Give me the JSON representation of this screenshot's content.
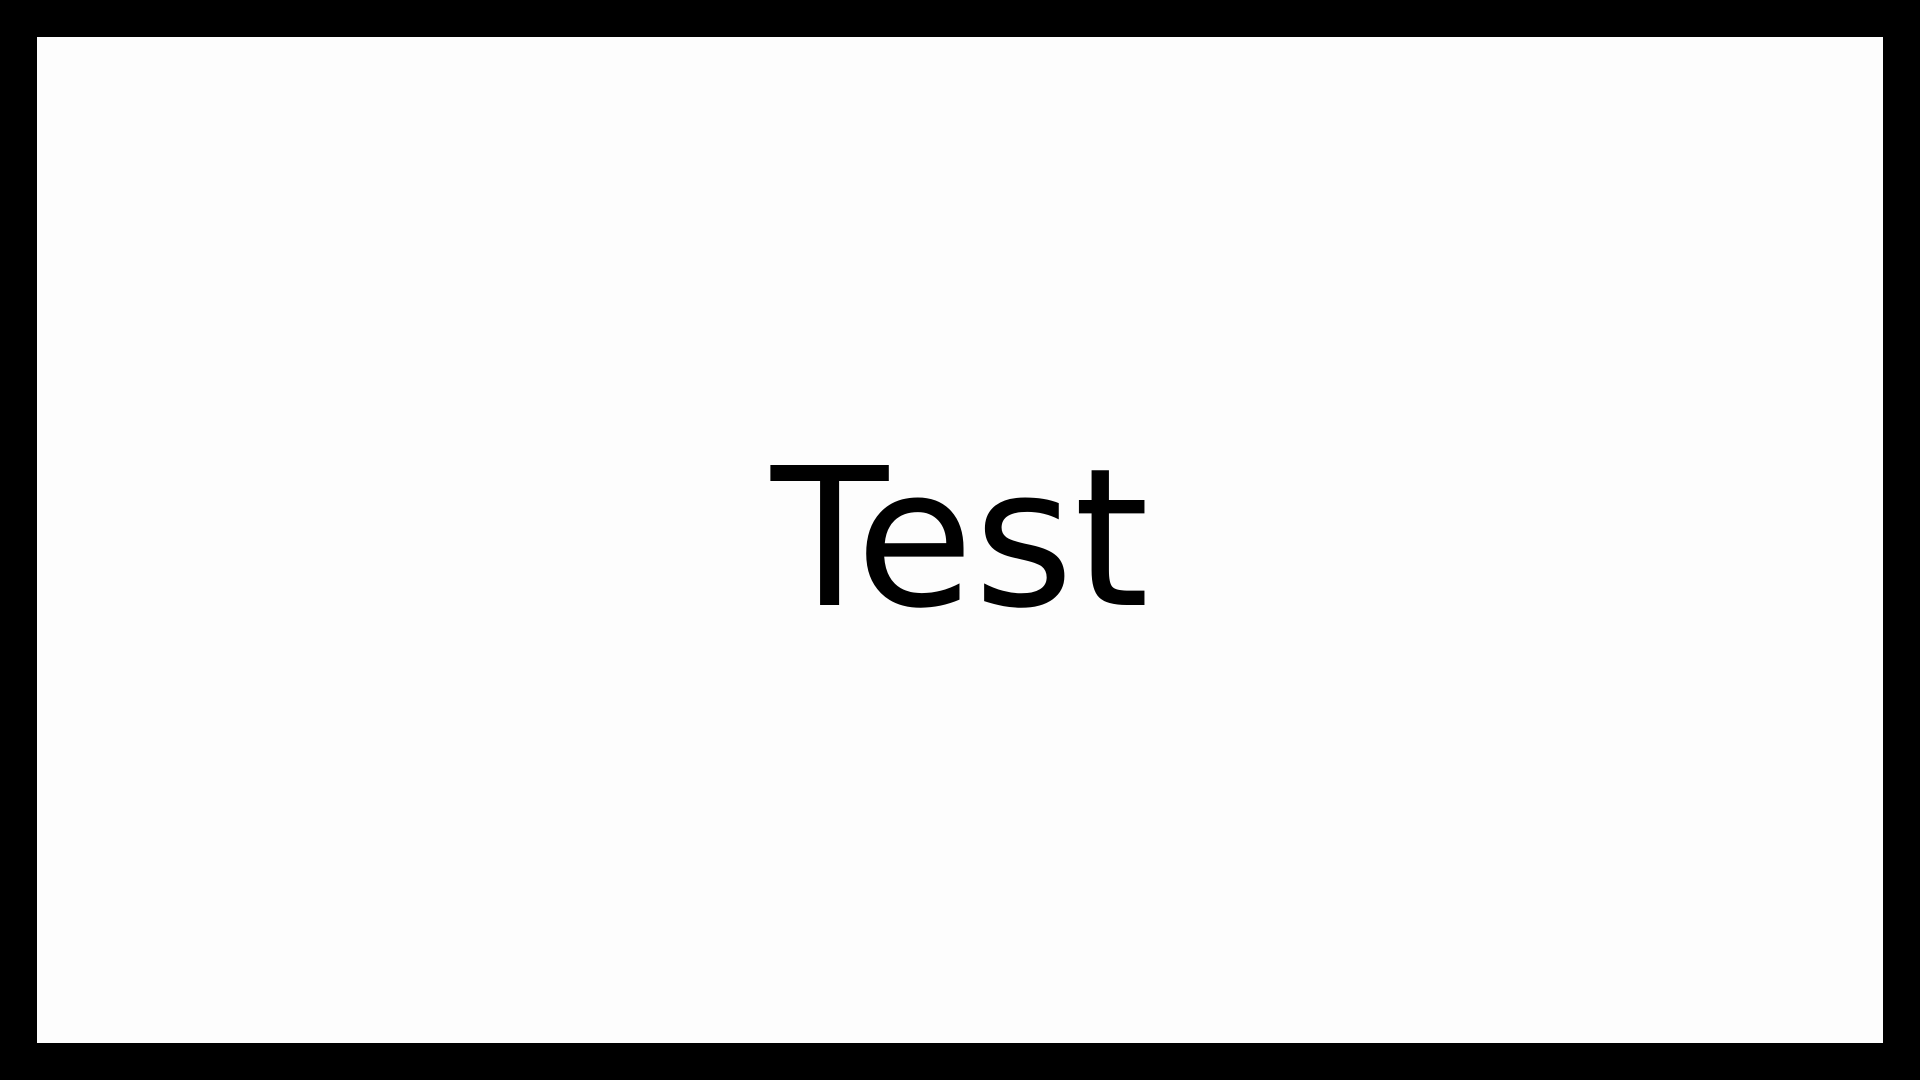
{
  "main": {
    "text": "Test"
  },
  "colors": {
    "frame": "#000000",
    "background": "#fdfdfd",
    "text": "#000000"
  }
}
